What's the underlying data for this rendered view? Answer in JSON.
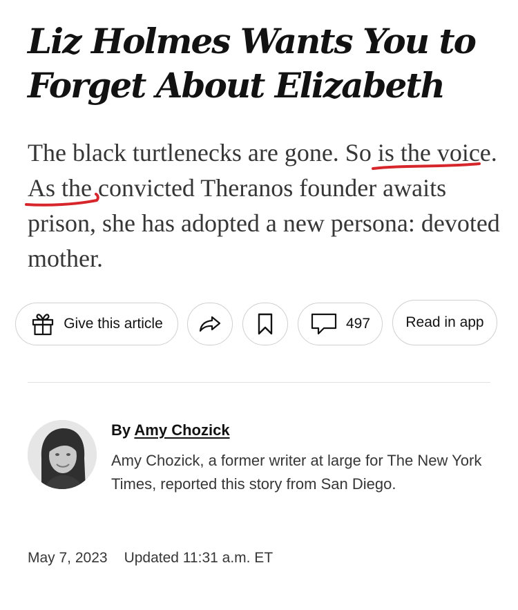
{
  "article": {
    "headline": "Liz Holmes Wants You to Forget About Elizabeth",
    "summary_part1": "The black turtlenecks are gone. ",
    "summary_highlight1": "So is the",
    "summary_part2": " ",
    "summary_highlight2": "voice.",
    "summary_part3": " As the convicted Theranos founder awaits prison, she has adopted a new persona: devoted mother."
  },
  "actions": {
    "gift_label": "Give this article",
    "comment_count": "497",
    "read_in_app_label": "Read in app",
    "icons": {
      "gift": "gift-icon",
      "share": "share-arrow-icon",
      "save": "bookmark-icon",
      "comments": "comment-bubble-icon"
    }
  },
  "byline": {
    "prefix": "By",
    "author": "Amy Chozick",
    "bio": "Amy Chozick, a former writer at large for The New York Times, reported this story from San Diego."
  },
  "dates": {
    "published": "May 7, 2023",
    "updated": "Updated 11:31 a.m. ET"
  },
  "colors": {
    "markup_red": "#d6262b",
    "text_dark": "#121212",
    "text_body": "#363636",
    "border": "#cfcfcf"
  }
}
